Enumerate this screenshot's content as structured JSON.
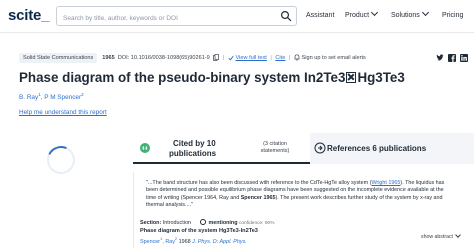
{
  "header": {
    "logo_main": "scite",
    "logo_underscore": "_",
    "search_placeholder": "Search by title, author, keywords or DOI",
    "nav": [
      {
        "label": "Assistant"
      },
      {
        "label": "Product"
      },
      {
        "label": "Solutions"
      },
      {
        "label": "Pricing"
      }
    ]
  },
  "article": {
    "journal": "Solid State Communications",
    "year": "1965",
    "doi": "DOI: 10.1016/0038-1098(65)90261-9",
    "view_full_text": "View full text",
    "cite": "Cite",
    "alerts": "Sign up to set email alerts",
    "social": [
      "t",
      "f",
      "in"
    ],
    "title_before": "Phase diagram of the pseudo-binary system In2Te3",
    "title_after": "Hg3Te3",
    "authors": [
      {
        "name": "B. Ray",
        "sup": "1"
      },
      {
        "name": "P M Spencer",
        "sup": "2"
      }
    ],
    "help_link": "Help me understand this report"
  },
  "tabs": {
    "cited_by_line1": "Cited by 10",
    "cited_by_line2": "publications",
    "citation_statements_line1": "(3 citation",
    "citation_statements_line2": "statements)",
    "references": "References 6 publications"
  },
  "citation": {
    "quote_1": "\"...The band structure has also been discussed with reference to the CdTe-HgTe alloy system (",
    "quote_link_1": "Wright 1965",
    "quote_2": "). The liquidus has been determined and possible equilibrium phase diagrams have been suggested on the incomplete evidence available at the time of writing (Spencer 1964, Ray and ",
    "quote_bold": "Spencer 1965",
    "quote_3": "). The present work describes further study of the system by x-ray and thermal analysis....\"",
    "section_label": "Section:",
    "section_value": "Introduction",
    "mention_label": "mentioning",
    "confidence": "confidence: 90%",
    "show_abstract": "show abstract",
    "cited_title": "Phase diagram of the system Hg3Te3-In2Te3",
    "cited_author_1": "Spencer",
    "cited_author_1_sup": "1",
    "cited_author_2": "Ray",
    "cited_author_2_sup": "2",
    "cited_year": "1968",
    "cited_journal": "J. Phys. D: Appl. Phys."
  },
  "colors": {
    "accent": "#2c6fcf",
    "text": "#1f2a37",
    "tab_inactive_bg": "#f3f5f8"
  }
}
